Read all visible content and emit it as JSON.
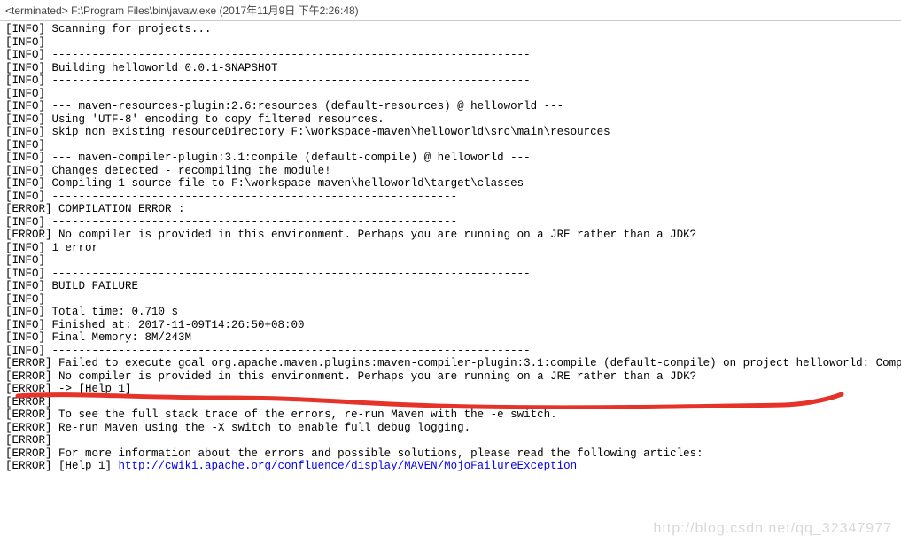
{
  "header": {
    "status": "<terminated>",
    "path": "F:\\Program Files\\bin\\javaw.exe",
    "timestamp": "(2017年11月9日 下午2:26:48)"
  },
  "lines": [
    {
      "tag": "[INFO]",
      "text": " Scanning for projects..."
    },
    {
      "tag": "[INFO]",
      "text": ""
    },
    {
      "tag": "[INFO]",
      "text": " ------------------------------------------------------------------------"
    },
    {
      "tag": "[INFO]",
      "text": " Building helloworld 0.0.1-SNAPSHOT"
    },
    {
      "tag": "[INFO]",
      "text": " ------------------------------------------------------------------------"
    },
    {
      "tag": "[INFO]",
      "text": ""
    },
    {
      "tag": "[INFO]",
      "text": " --- maven-resources-plugin:2.6:resources (default-resources) @ helloworld ---"
    },
    {
      "tag": "[INFO]",
      "text": " Using 'UTF-8' encoding to copy filtered resources."
    },
    {
      "tag": "[INFO]",
      "text": " skip non existing resourceDirectory F:\\workspace-maven\\helloworld\\src\\main\\resources"
    },
    {
      "tag": "[INFO]",
      "text": ""
    },
    {
      "tag": "[INFO]",
      "text": " --- maven-compiler-plugin:3.1:compile (default-compile) @ helloworld ---"
    },
    {
      "tag": "[INFO]",
      "text": " Changes detected - recompiling the module!"
    },
    {
      "tag": "[INFO]",
      "text": " Compiling 1 source file to F:\\workspace-maven\\helloworld\\target\\classes"
    },
    {
      "tag": "[INFO]",
      "text": " -------------------------------------------------------------"
    },
    {
      "tag": "[ERROR]",
      "text": " COMPILATION ERROR :"
    },
    {
      "tag": "[INFO]",
      "text": " -------------------------------------------------------------"
    },
    {
      "tag": "[ERROR]",
      "text": " No compiler is provided in this environment. Perhaps you are running on a JRE rather than a JDK?"
    },
    {
      "tag": "[INFO]",
      "text": " 1 error"
    },
    {
      "tag": "[INFO]",
      "text": " -------------------------------------------------------------"
    },
    {
      "tag": "[INFO]",
      "text": " ------------------------------------------------------------------------"
    },
    {
      "tag": "[INFO]",
      "text": " BUILD FAILURE"
    },
    {
      "tag": "[INFO]",
      "text": " ------------------------------------------------------------------------"
    },
    {
      "tag": "[INFO]",
      "text": " Total time: 0.710 s"
    },
    {
      "tag": "[INFO]",
      "text": " Finished at: 2017-11-09T14:26:50+08:00"
    },
    {
      "tag": "[INFO]",
      "text": " Final Memory: 8M/243M"
    },
    {
      "tag": "[INFO]",
      "text": " ------------------------------------------------------------------------"
    },
    {
      "tag": "[ERROR]",
      "text": " Failed to execute goal org.apache.maven.plugins:maven-compiler-plugin:3.1:compile (default-compile) on project helloworld: Compilation f"
    },
    {
      "tag": "[ERROR]",
      "text": " No compiler is provided in this environment. Perhaps you are running on a JRE rather than a JDK?"
    },
    {
      "tag": "[ERROR]",
      "text": " -> [Help 1]"
    },
    {
      "tag": "[ERROR]",
      "text": ""
    },
    {
      "tag": "[ERROR]",
      "text": " To see the full stack trace of the errors, re-run Maven with the -e switch."
    },
    {
      "tag": "[ERROR]",
      "text": " Re-run Maven using the -X switch to enable full debug logging."
    },
    {
      "tag": "[ERROR]",
      "text": ""
    },
    {
      "tag": "[ERROR]",
      "text": " For more information about the errors and possible solutions, please read the following articles:"
    },
    {
      "tag": "[ERROR]",
      "text": " [Help 1] ",
      "link": "http://cwiki.apache.org/confluence/display/MAVEN/MojoFailureException"
    }
  ],
  "watermark": "http://blog.csdn.net/qq_32347977"
}
